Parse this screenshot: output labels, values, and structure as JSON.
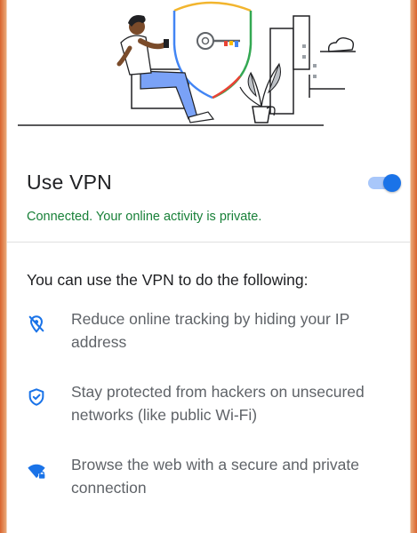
{
  "vpn": {
    "title": "Use VPN",
    "toggle_state": "on",
    "status": "Connected. Your online activity is private."
  },
  "features": {
    "heading": "You can use the VPN to do the following:",
    "items": [
      {
        "icon": "location-off-icon",
        "text": "Reduce online tracking by hiding your IP address"
      },
      {
        "icon": "shield-check-icon",
        "text": "Stay protected from hackers on unsecured networks (like public Wi-Fi)"
      },
      {
        "icon": "wifi-lock-icon",
        "text": "Browse the web with a secure and private connection"
      }
    ]
  },
  "colors": {
    "accent": "#1a73e8",
    "toggle_track": "#a8c7fa",
    "status_green": "#188038",
    "frame_orange": "#d9632e"
  }
}
